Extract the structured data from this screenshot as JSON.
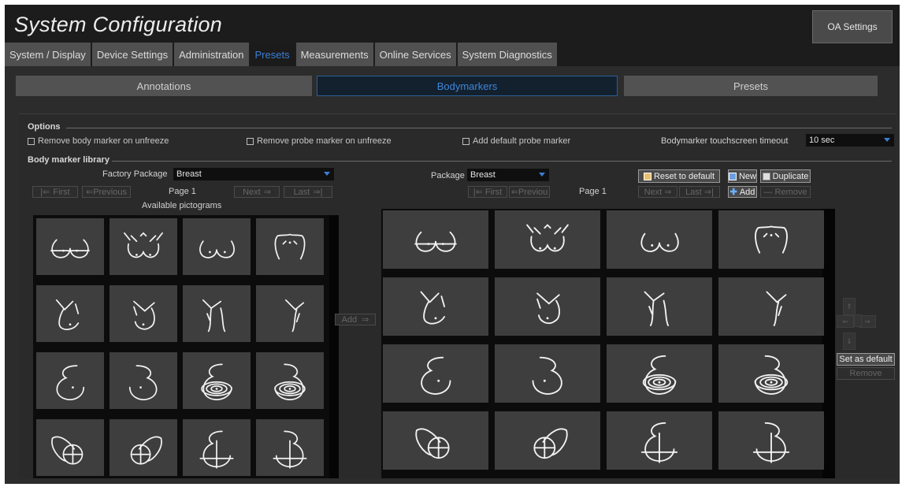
{
  "header": {
    "title": "System Configuration",
    "oa_settings_label": "OA Settings"
  },
  "tabs": [
    {
      "label": "System / Display"
    },
    {
      "label": "Device Settings"
    },
    {
      "label": "Administration"
    },
    {
      "label": "Presets",
      "active": true
    },
    {
      "label": "Measurements"
    },
    {
      "label": "Online Services"
    },
    {
      "label": "System Diagnostics"
    }
  ],
  "subtabs": [
    {
      "label": "Annotations"
    },
    {
      "label": "Bodymarkers",
      "active": true
    },
    {
      "label": "Presets"
    }
  ],
  "options": {
    "title": "Options",
    "remove_body_marker": "Remove body marker on unfreeze",
    "remove_probe_marker": "Remove probe marker on unfreeze",
    "add_default_probe": "Add default probe marker",
    "timeout_label": "Bodymarker touchscreen timeout",
    "timeout_value": "10 sec"
  },
  "library": {
    "title": "Body marker library",
    "factory_package_label": "Factory Package",
    "factory_package_value": "Breast",
    "left_nav": {
      "first": "First",
      "previous": "Previous",
      "page": "Page 1",
      "next": "Next",
      "last": "Last"
    },
    "available_label": "Available pictograms",
    "add_label": "Add",
    "package_label": "Package",
    "package_value": "Breast",
    "right_nav": {
      "first": "First",
      "previous": "Previou",
      "page": "Page 1",
      "next": "Next",
      "last": "Last"
    },
    "reset_label": "Reset to default",
    "new_label": "New",
    "duplicate_label": "Duplicate",
    "add_btn_label": "Add",
    "remove_label": "Remove",
    "set_default_label": "Set as default",
    "remove2_label": "Remove"
  },
  "pictograms": [
    "breasts-front-a",
    "torso-front",
    "breasts-front-b",
    "torso-back",
    "side-left",
    "side-right",
    "side-line-left",
    "side-line-right",
    "breast-left",
    "breast-right",
    "breast-left-rings",
    "breast-right-rings",
    "breast-quadrant-left",
    "breast-quadrant-right",
    "breast-crosshair-left",
    "breast-crosshair-right"
  ],
  "colors": {
    "accent": "#3a7fd6",
    "background": "#1c1c1c",
    "panel": "#2c2c2c",
    "cell": "#3e3e3e",
    "stroke": "#f2f2f2"
  }
}
